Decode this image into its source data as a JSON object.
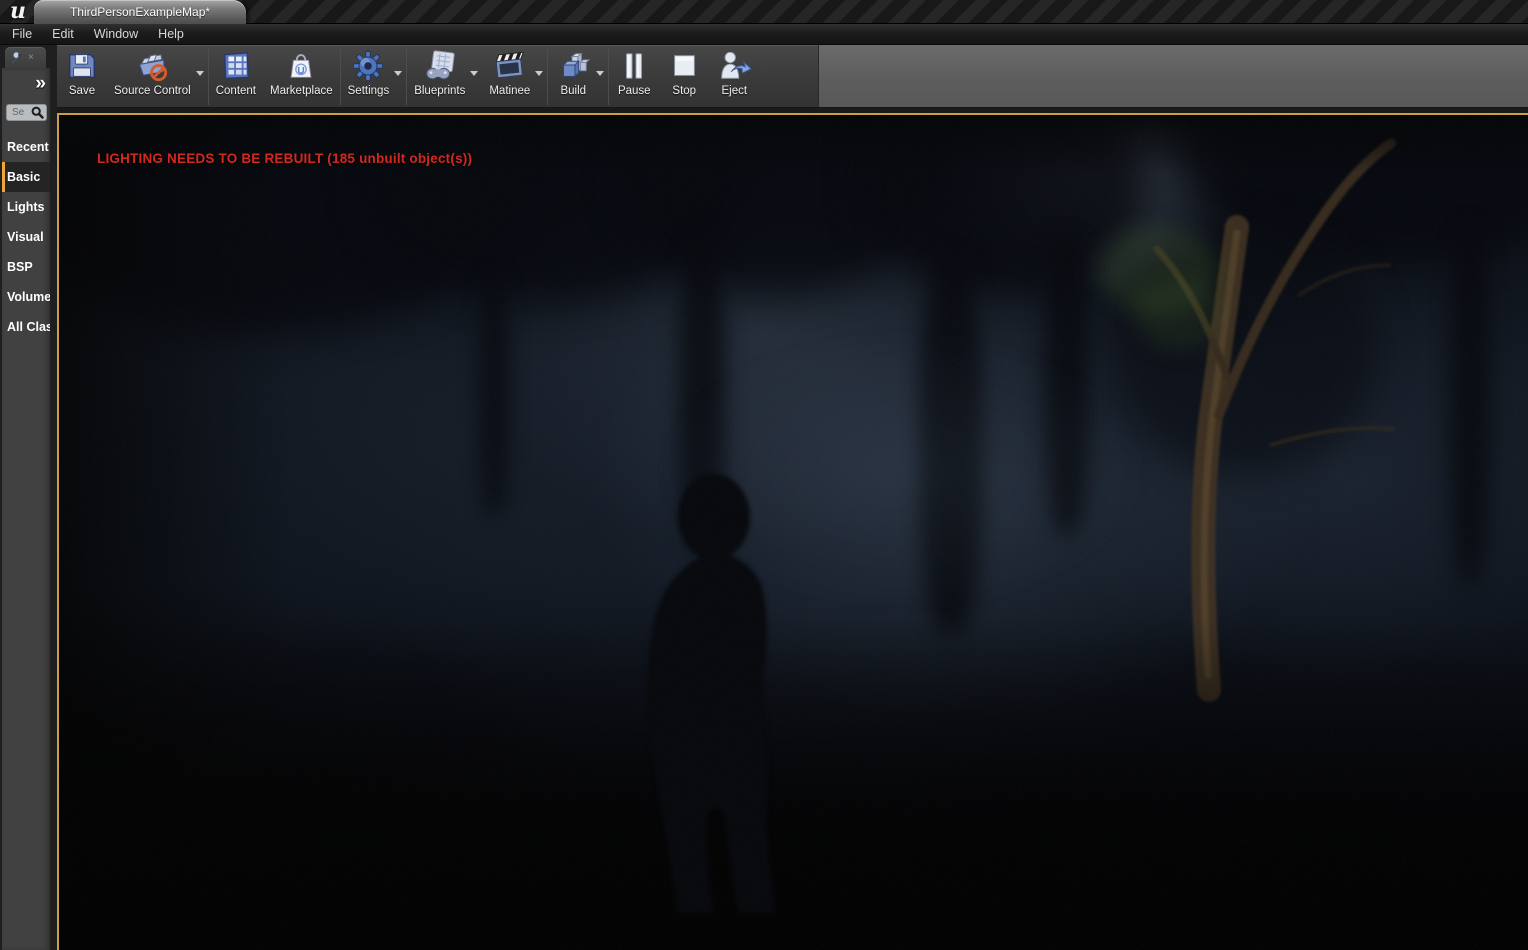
{
  "window": {
    "logo_glyph": "u",
    "tab_title": "ThirdPersonExampleMap*"
  },
  "menubar": {
    "items": [
      "File",
      "Edit",
      "Window",
      "Help"
    ]
  },
  "toolbar": {
    "buttons": [
      {
        "label": "Save",
        "icon": "save-icon"
      },
      {
        "label": "Source Control",
        "icon": "source-control-icon",
        "has_dropdown": true
      },
      {
        "label": "Content",
        "icon": "content-browser-icon"
      },
      {
        "label": "Marketplace",
        "icon": "marketplace-icon"
      },
      {
        "label": "Settings",
        "icon": "settings-gear-icon",
        "has_dropdown": true
      },
      {
        "label": "Blueprints",
        "icon": "blueprints-icon",
        "has_dropdown": true
      },
      {
        "label": "Matinee",
        "icon": "matinee-icon",
        "has_dropdown": true
      },
      {
        "label": "Build",
        "icon": "build-icon",
        "has_dropdown": true
      },
      {
        "label": "Pause",
        "icon": "pause-icon"
      },
      {
        "label": "Stop",
        "icon": "stop-icon"
      },
      {
        "label": "Eject",
        "icon": "eject-icon"
      }
    ]
  },
  "modes_panel": {
    "tab_icon": "wrench-icon",
    "close_glyph": "×",
    "expand_glyph": "»",
    "search_text": "Se",
    "search_icon": "magnifier-icon",
    "items": [
      {
        "label": "Recent"
      },
      {
        "label": "Basic",
        "selected": true
      },
      {
        "label": "Lights"
      },
      {
        "label": "Visual"
      },
      {
        "label": "BSP"
      },
      {
        "label": "Volume"
      },
      {
        "label": "All Clas"
      }
    ]
  },
  "viewport": {
    "warning": "LIGHTING NEEDS TO BE REBUILT (185 unbuilt object(s))",
    "warning_color": "#d3281f",
    "pie_border_color": "#c9a23f",
    "selection_accent_color": "#efa537",
    "scene_description": "dark foggy night forest with third-person character silhouette"
  }
}
